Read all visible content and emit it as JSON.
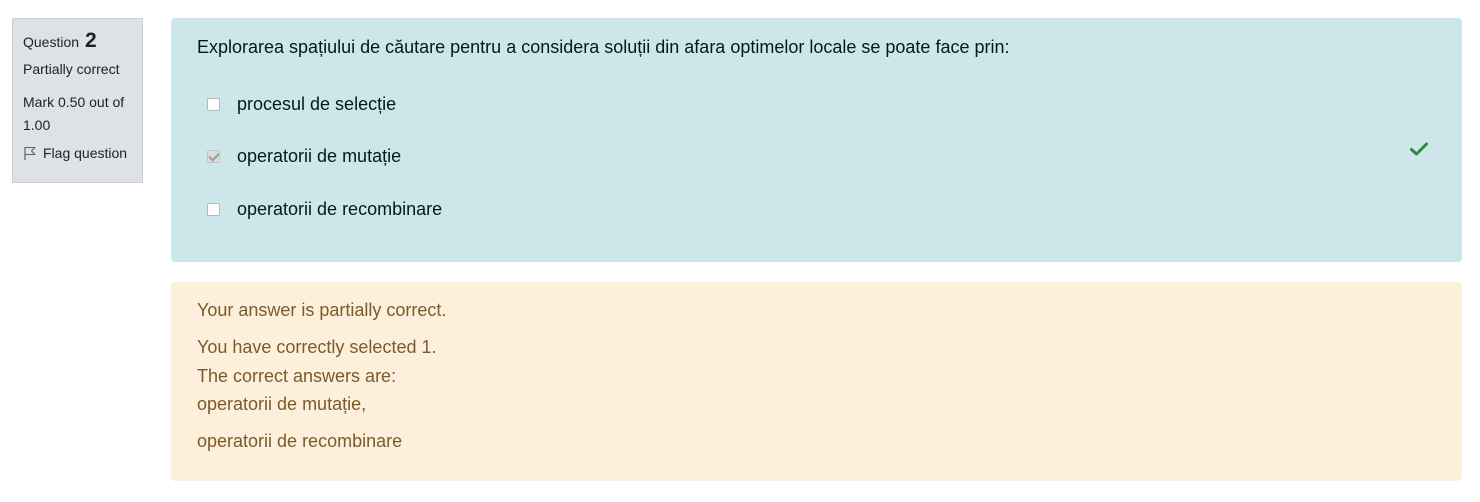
{
  "info": {
    "question_label": "Question",
    "question_number": "2",
    "state": "Partially correct",
    "grade": "Mark 0.50 out of 1.00",
    "flag_label": "Flag question",
    "flag_icon": "flag-icon"
  },
  "question": {
    "text": "Explorarea spațiului de căutare pentru a considera soluții din afara optimelor locale se poate face prin:",
    "answers": [
      {
        "label": "procesul de selecție",
        "checked": false
      },
      {
        "label": "operatorii de mutație",
        "checked": true,
        "correct_icon": "checkmark-icon"
      },
      {
        "label": "operatorii de recombinare",
        "checked": false
      }
    ]
  },
  "feedback": {
    "general": "Your answer is partially correct.",
    "selected": "You have correctly selected 1.",
    "intro": "The correct answers are:",
    "correct_answers": [
      "operatorii de mutație,",
      "operatorii de recombinare"
    ]
  },
  "colors": {
    "info_bg": "#dee2e6",
    "formulation_bg": "#cce6ea",
    "feedback_bg": "#fcefdc",
    "feedback_text": "#7d5a29",
    "correct_green": "#2e8b3a"
  }
}
